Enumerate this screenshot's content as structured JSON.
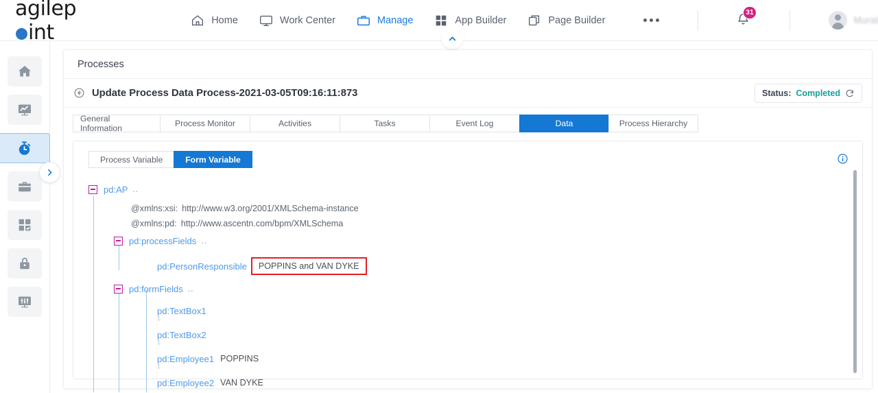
{
  "brand": {
    "name_part1": "agilep",
    "name_part2": "int",
    "dot_color": "#2a76c8"
  },
  "topnav": {
    "items": [
      {
        "label": "Home",
        "icon": "home-icon",
        "active": false
      },
      {
        "label": "Work Center",
        "icon": "monitor-icon",
        "active": false
      },
      {
        "label": "Manage",
        "icon": "briefcase-icon",
        "active": true
      },
      {
        "label": "App Builder",
        "icon": "grid-icon",
        "active": false
      },
      {
        "label": "Page Builder",
        "icon": "copy-icon",
        "active": false
      }
    ],
    "more_label": "•••",
    "notification_count": "31",
    "username": "MuraliGowda",
    "accent_color": "#1a7ae0",
    "badge_color": "#d6217f"
  },
  "sidebar": {
    "items": [
      {
        "icon": "home-icon",
        "name": "sidebar-item-home",
        "active": false
      },
      {
        "icon": "analytics-monitor-icon",
        "name": "sidebar-item-analytics",
        "active": false
      },
      {
        "icon": "stopwatch-icon",
        "name": "sidebar-item-processes",
        "active": true
      },
      {
        "icon": "briefcase-icon",
        "name": "sidebar-item-portfolio",
        "active": false
      },
      {
        "icon": "app-grid-check-icon",
        "name": "sidebar-item-apps",
        "active": false
      },
      {
        "icon": "lock-icon",
        "name": "sidebar-item-security",
        "active": false
      },
      {
        "icon": "settings-monitor-icon",
        "name": "sidebar-item-settings",
        "active": false
      }
    ],
    "expand_icon": "chevron-right-icon"
  },
  "page": {
    "breadcrumb": "Processes",
    "title": "Update Process Data Process-2021-03-05T09:16:11:873",
    "back_icon": "arrow-left-circle-icon",
    "status_label": "Status:",
    "status_value": "Completed",
    "status_color": "#12a29a",
    "refresh_icon": "refresh-icon",
    "collapse_icon": "chevron-up-icon"
  },
  "tabs": [
    {
      "label": "General Information",
      "active": false,
      "width": 127
    },
    {
      "label": "Process Monitor",
      "active": false,
      "width": 131
    },
    {
      "label": "Activities",
      "active": false,
      "width": 131
    },
    {
      "label": "Tasks",
      "active": false,
      "width": 131
    },
    {
      "label": "Event Log",
      "active": false,
      "width": 131
    },
    {
      "label": "Data",
      "active": true,
      "width": 130
    },
    {
      "label": "Process Hierarchy",
      "active": false,
      "width": 131
    }
  ],
  "variable_toggle": [
    {
      "label": "Process Variable",
      "active": false
    },
    {
      "label": "Form Variable",
      "active": true
    }
  ],
  "info_icon": "info-circle-icon",
  "tree": {
    "root": {
      "key": "pd:AP",
      "ellipsis": ".."
    },
    "attributes": [
      {
        "key": "@xmlns:xsi:",
        "value": "http://www.w3.org/2001/XMLSchema-instance"
      },
      {
        "key": "@xmlns:pd:",
        "value": "http://www.ascentn.com/bpm/XMLSchema"
      }
    ],
    "process_fields": {
      "key": "pd:processFields",
      "ellipsis": "..",
      "children": [
        {
          "key": "pd:PersonResponsible",
          "value": "POPPINS and VAN DYKE",
          "highlighted": true
        }
      ]
    },
    "form_fields": {
      "key": "pd:formFields",
      "ellipsis": "..",
      "children": [
        {
          "key": "pd:TextBox1",
          "value": "",
          "highlighted": false
        },
        {
          "key": "pd:TextBox2",
          "value": "",
          "highlighted": false
        },
        {
          "key": "pd:Employee1",
          "value": "POPPINS",
          "highlighted": false
        },
        {
          "key": "pd:Employee2",
          "value": "VAN DYKE",
          "highlighted": false
        }
      ]
    },
    "highlight_color": "#e31e24",
    "node_color": "#4f9ae8",
    "toggle_color": "#c2189a"
  }
}
